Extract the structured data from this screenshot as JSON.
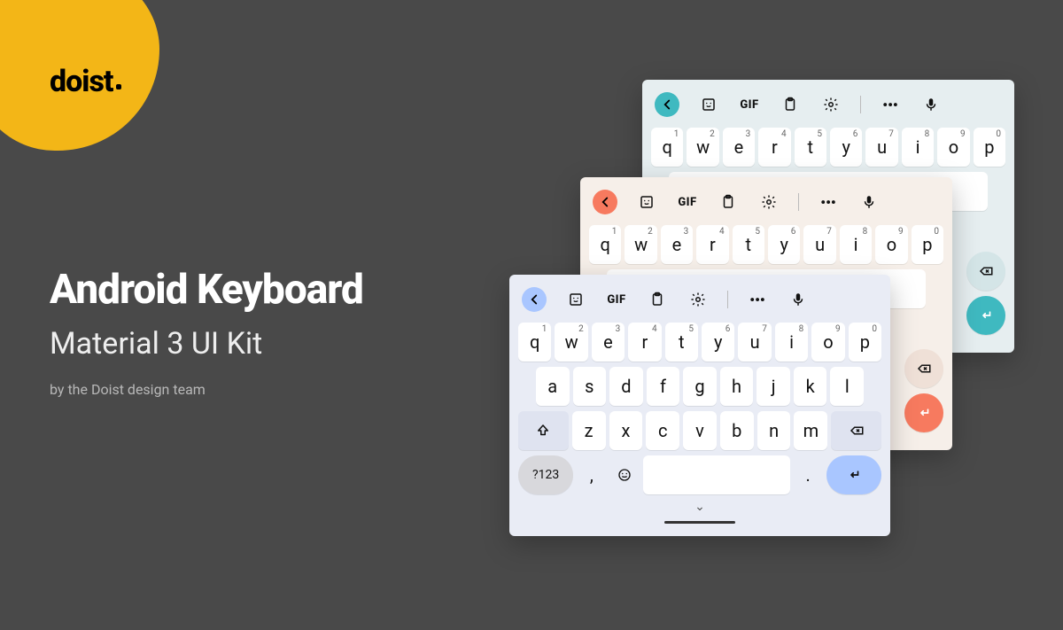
{
  "brand": {
    "logo": "doist"
  },
  "headline": {
    "title": "Android Keyboard",
    "subtitle": "Material 3 UI Kit",
    "byline": "by the Doist design team"
  },
  "toolbar": {
    "gif": "GIF"
  },
  "keyboard": {
    "row1": [
      {
        "k": "q",
        "n": "1"
      },
      {
        "k": "w",
        "n": "2"
      },
      {
        "k": "e",
        "n": "3"
      },
      {
        "k": "r",
        "n": "4"
      },
      {
        "k": "t",
        "n": "5"
      },
      {
        "k": "y",
        "n": "6"
      },
      {
        "k": "u",
        "n": "7"
      },
      {
        "k": "i",
        "n": "8"
      },
      {
        "k": "o",
        "n": "9"
      },
      {
        "k": "p",
        "n": "0"
      }
    ],
    "row2": [
      "a",
      "s",
      "d",
      "f",
      "g",
      "h",
      "j",
      "k",
      "l"
    ],
    "row3": [
      "z",
      "x",
      "c",
      "v",
      "b",
      "n",
      "m"
    ],
    "symbols": "?123",
    "comma": ",",
    "period": "."
  },
  "colors": {
    "bg": "#494949",
    "blob": "#f3b617",
    "teal": "#3fb9c0",
    "peach": "#f77a5f",
    "blue": "#a9c6ff"
  }
}
